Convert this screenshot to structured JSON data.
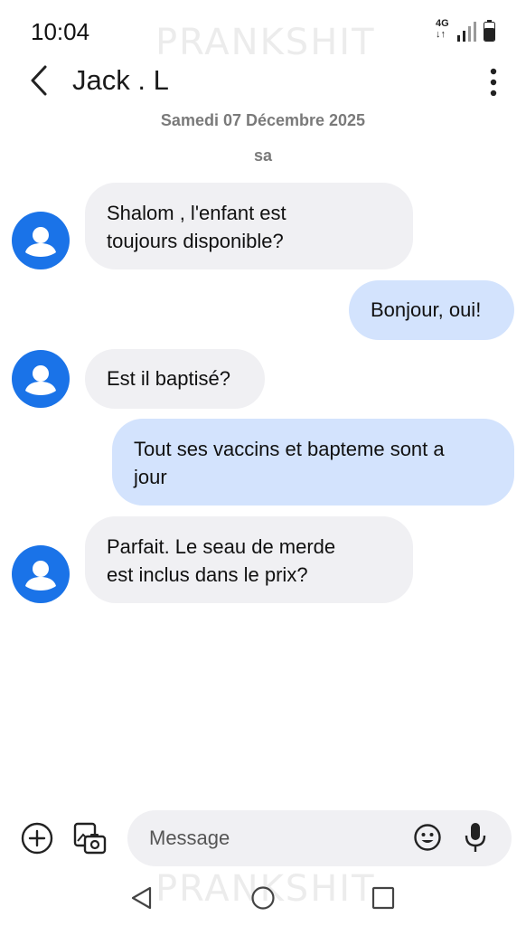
{
  "watermark": "PRANKSHIT",
  "status_bar": {
    "time": "10:04",
    "network": "4G",
    "network_arrows": "↓↑"
  },
  "app_bar": {
    "contact_name": "Jack . L"
  },
  "conversation": {
    "date": "Samedi 07 Décembre 2025",
    "day": "sa",
    "messages": [
      {
        "direction": "incoming",
        "lines": [
          "Shalom , l'enfant est",
          "toujours disponible?"
        ]
      },
      {
        "direction": "outgoing",
        "lines": [
          "Bonjour, oui!"
        ]
      },
      {
        "direction": "incoming",
        "lines": [
          "Est il baptisé?"
        ]
      },
      {
        "direction": "outgoing",
        "lines": [
          "Tout ses vaccins et bapteme sont a",
          "jour"
        ]
      },
      {
        "direction": "incoming",
        "lines": [
          "Parfait. Le seau de merde",
          "est inclus dans le prix?"
        ]
      }
    ]
  },
  "composer": {
    "placeholder": "Message"
  },
  "icons": {
    "back": "chevron-left-icon",
    "more": "more-vert-icon",
    "add": "add-circle-icon",
    "gallery": "gallery-camera-icon",
    "emoji": "emoji-icon",
    "mic": "mic-icon",
    "avatar": "person-icon"
  },
  "colors": {
    "incoming_bubble": "#f0f0f3",
    "outgoing_bubble": "#d3e3fd",
    "avatar": "#1a73e8"
  }
}
